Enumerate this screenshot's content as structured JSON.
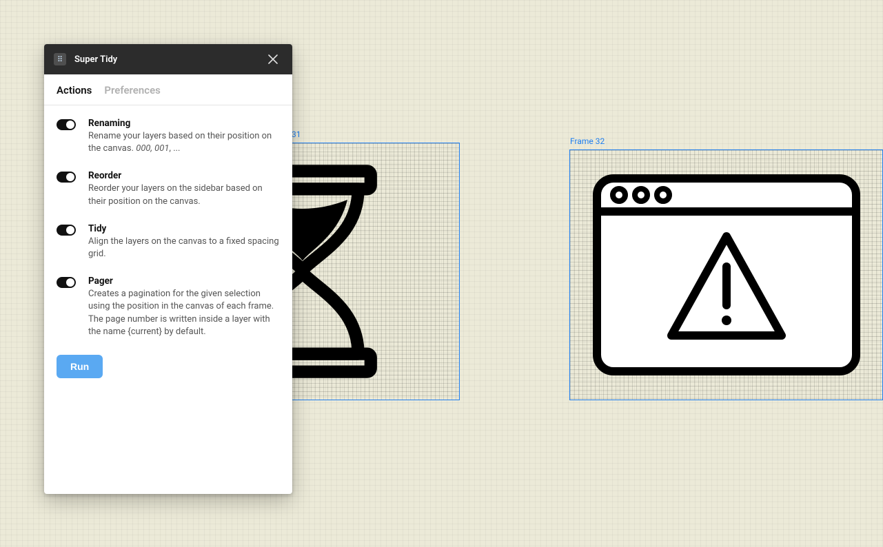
{
  "canvas": {
    "frames": [
      {
        "label": "31"
      },
      {
        "label": "Frame 32"
      }
    ]
  },
  "dialog": {
    "title": "Super Tidy",
    "tabs": {
      "actions": "Actions",
      "preferences": "Preferences"
    },
    "options": {
      "renaming": {
        "title": "Renaming",
        "desc_prefix": "Rename your layers based on their position on the canvas. ",
        "desc_em": "000, 001",
        "desc_suffix": ", ..."
      },
      "reorder": {
        "title": "Reorder",
        "desc": "Reorder your layers on the sidebar based on their position on the canvas."
      },
      "tidy": {
        "title": "Tidy",
        "desc": "Align the layers on the canvas to a fixed spacing grid."
      },
      "pager": {
        "title": "Pager",
        "desc": "Creates a pagination for the given selection using the position in the canvas of each frame. The page number is written inside a layer with the name {current} by default."
      }
    },
    "run_label": "Run"
  }
}
